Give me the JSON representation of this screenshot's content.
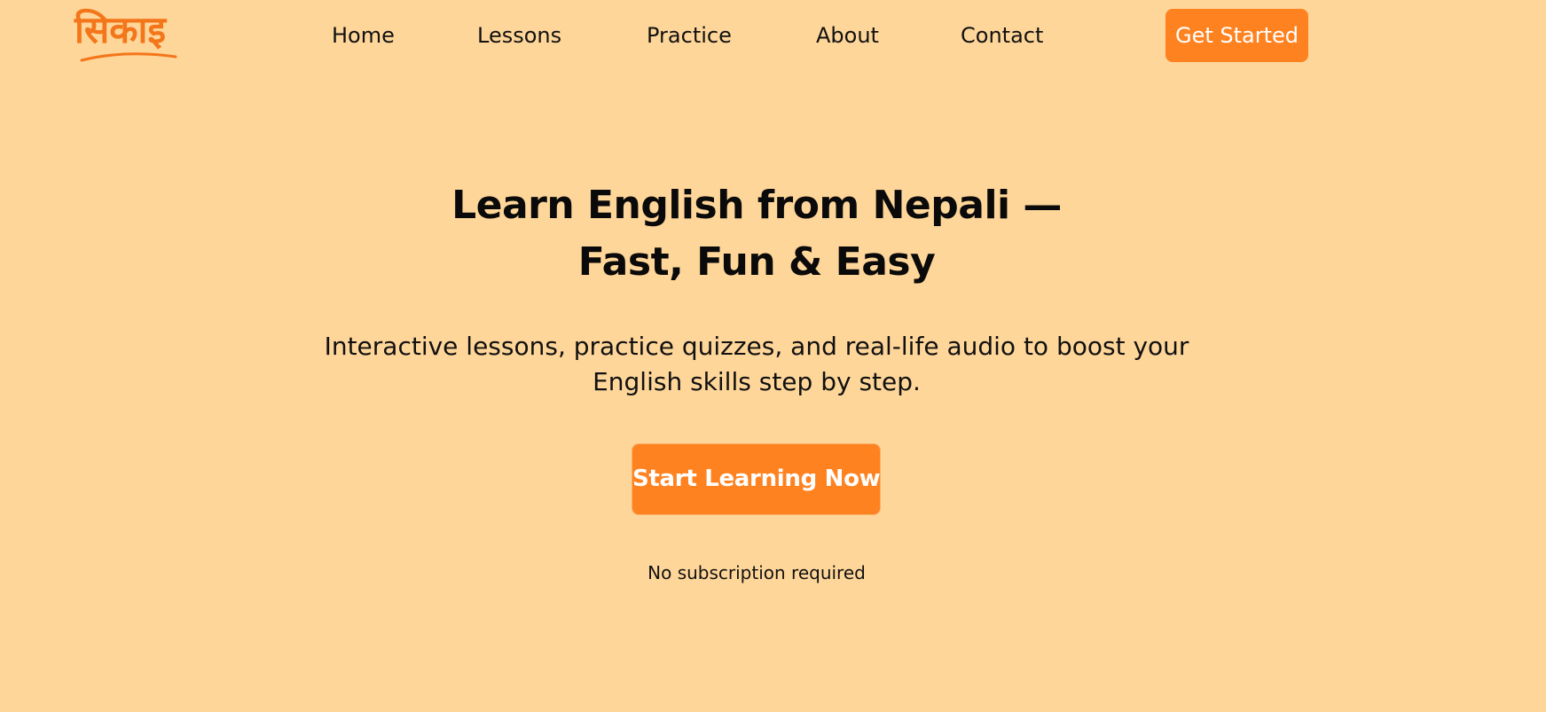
{
  "header": {
    "logo_text": "सिकाइ",
    "nav": {
      "home": "Home",
      "lessons": "Lessons",
      "practice": "Practice",
      "about": "About",
      "contact": "Contact"
    },
    "get_started_label": "Get Started"
  },
  "hero": {
    "title_line1": "Learn English from Nepali —",
    "title_line2": "Fast, Fun & Easy",
    "subtitle_line1": "Interactive lessons, practice quizzes, and real-life audio to boost your",
    "subtitle_line2": "English skills step by step.",
    "cta_label": "Start Learning Now",
    "note": "No subscription required"
  },
  "colors": {
    "background": "#FFD699",
    "accent": "#FF8220",
    "logo": "#F4761B"
  },
  "icons": {
    "logo_swoosh": "swoosh-underline-icon"
  }
}
